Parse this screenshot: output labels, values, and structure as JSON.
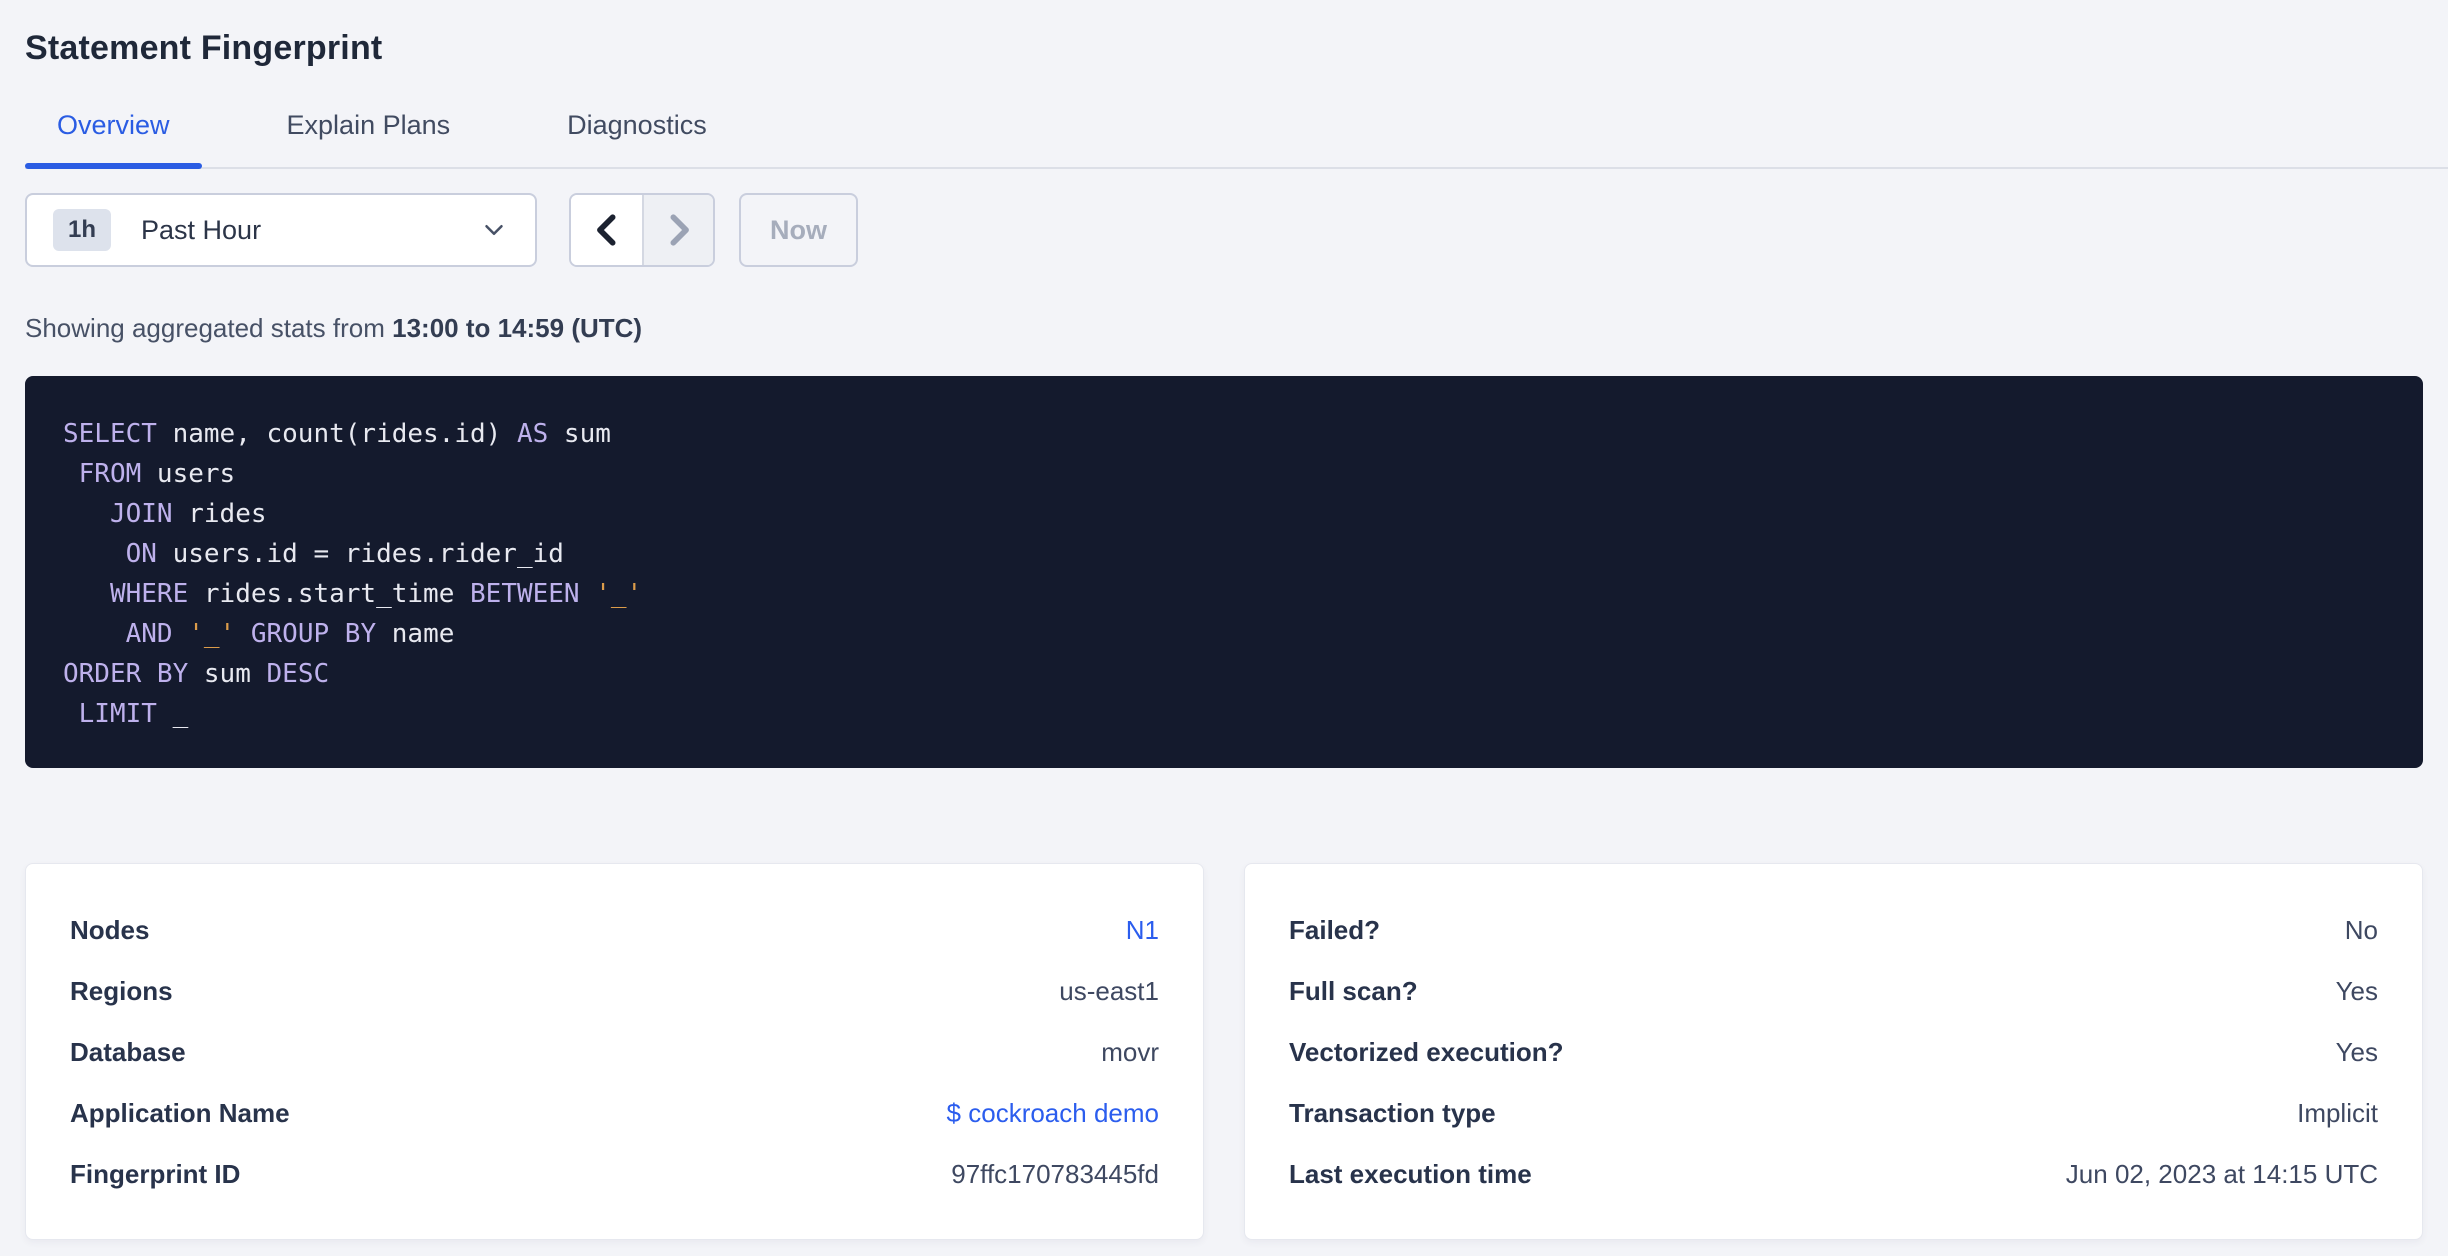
{
  "page": {
    "title": "Statement Fingerprint"
  },
  "tabs": [
    {
      "label": "Overview",
      "active": true
    },
    {
      "label": "Explain Plans",
      "active": false
    },
    {
      "label": "Diagnostics",
      "active": false
    }
  ],
  "time_picker": {
    "badge": "1h",
    "label": "Past Hour",
    "chevron_icon": "chevron-down-icon"
  },
  "time_nav": {
    "prev_icon": "chevron-left-icon",
    "next_icon": "chevron-right-icon",
    "now_label": "Now"
  },
  "stats_line": {
    "prefix": "Showing aggregated stats from ",
    "range": "13:00 to 14:59 (UTC)"
  },
  "sql": {
    "lines": [
      [
        [
          "k",
          "SELECT"
        ],
        [
          "p",
          " name, count(rides.id) "
        ],
        [
          "k",
          "AS"
        ],
        [
          "p",
          " sum"
        ]
      ],
      [
        [
          "p",
          " "
        ],
        [
          "k",
          "FROM"
        ],
        [
          "p",
          " users"
        ]
      ],
      [
        [
          "p",
          "   "
        ],
        [
          "k",
          "JOIN"
        ],
        [
          "p",
          " rides"
        ]
      ],
      [
        [
          "p",
          "    "
        ],
        [
          "k",
          "ON"
        ],
        [
          "p",
          " users.id = rides.rider_id"
        ]
      ],
      [
        [
          "p",
          "   "
        ],
        [
          "k",
          "WHERE"
        ],
        [
          "p",
          " rides.start_time "
        ],
        [
          "k",
          "BETWEEN"
        ],
        [
          "p",
          " "
        ],
        [
          "s",
          "'_'"
        ]
      ],
      [
        [
          "p",
          "    "
        ],
        [
          "k",
          "AND"
        ],
        [
          "p",
          " "
        ],
        [
          "s",
          "'_'"
        ],
        [
          "p",
          " "
        ],
        [
          "k",
          "GROUP BY"
        ],
        [
          "p",
          " name"
        ]
      ],
      [
        [
          "k",
          "ORDER BY"
        ],
        [
          "p",
          " sum "
        ],
        [
          "k",
          "DESC"
        ]
      ],
      [
        [
          "p",
          " "
        ],
        [
          "k",
          "LIMIT"
        ],
        [
          "p",
          " _"
        ]
      ]
    ]
  },
  "cards": {
    "left": {
      "rows": [
        {
          "label": "Nodes",
          "value": "N1",
          "link": true
        },
        {
          "label": "Regions",
          "value": "us-east1",
          "link": false
        },
        {
          "label": "Database",
          "value": "movr",
          "link": false
        },
        {
          "label": "Application Name",
          "value": "$ cockroach demo",
          "link": true
        },
        {
          "label": "Fingerprint ID",
          "value": "97ffc170783445fd",
          "link": false
        }
      ]
    },
    "right": {
      "rows": [
        {
          "label": "Failed?",
          "value": "No",
          "link": false
        },
        {
          "label": "Full scan?",
          "value": "Yes",
          "link": false
        },
        {
          "label": "Vectorized execution?",
          "value": "Yes",
          "link": false
        },
        {
          "label": "Transaction type",
          "value": "Implicit",
          "link": false
        },
        {
          "label": "Last execution time",
          "value": "Jun 02, 2023 at 14:15 UTC",
          "link": false
        }
      ]
    }
  },
  "colors": {
    "accent_blue": "#2a5ce3",
    "link_blue": "#2b5dee",
    "sql_background": "#141a2d",
    "sql_keyword": "#beb1ec",
    "sql_plain": "#e8e9f0",
    "sql_string": "#dc9c4a",
    "page_background": "#f3f4f8"
  }
}
